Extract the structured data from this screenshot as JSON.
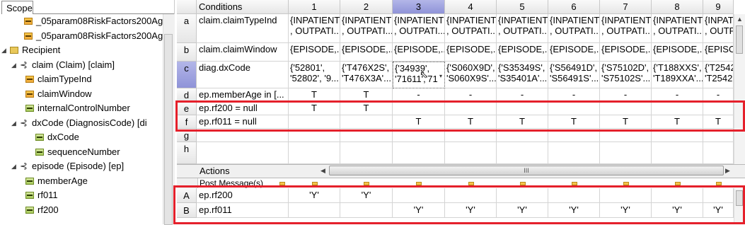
{
  "scope": {
    "tab_label": "Scope",
    "tree": [
      {
        "label": "_05param08RiskFactors200Ag",
        "icon": "field-icon"
      },
      {
        "label": "_05param08RiskFactors200Ag",
        "icon": "field-icon"
      },
      {
        "label": "Recipient",
        "icon": "object-icon",
        "toggle": "◢"
      },
      {
        "label": "claim (Claim) [claim]",
        "icon": "relation-icon",
        "toggle": "◢"
      },
      {
        "label": "claimTypeInd",
        "icon": "field-icon"
      },
      {
        "label": "claimWindow",
        "icon": "field-icon"
      },
      {
        "label": "internalControlNumber",
        "icon": "green-field-icon"
      },
      {
        "label": "dxCode (DiagnosisCode) [di",
        "icon": "relation-icon",
        "toggle": "◢"
      },
      {
        "label": "dxCode",
        "icon": "green-field-icon"
      },
      {
        "label": "sequenceNumber",
        "icon": "green-field-icon"
      },
      {
        "label": "episode (Episode) [ep]",
        "icon": "relation-icon",
        "toggle": "◢"
      },
      {
        "label": "memberAge",
        "icon": "green-field-icon"
      },
      {
        "label": "rf011",
        "icon": "green-field-icon"
      },
      {
        "label": "rf200",
        "icon": "green-field-icon"
      }
    ]
  },
  "grid": {
    "conditions_header": "Conditions",
    "columns": [
      "1",
      "2",
      "3",
      "4",
      "5",
      "6",
      "7",
      "8",
      "9"
    ],
    "selected_column": "3",
    "conditions": [
      {
        "letter": "a",
        "label": "claim.claimTypeInd",
        "cells": [
          [
            "{INPATIENT",
            ", OUTPATI..."
          ],
          [
            "{INPATIENT",
            ", OUTPATI..."
          ],
          [
            "{INPATIENT",
            ", OUTPATI..."
          ],
          [
            "{INPATIENT",
            ", OUTPATI..."
          ],
          [
            "{INPATIENT",
            ", OUTPATI..."
          ],
          [
            "{INPATIENT",
            ", OUTPATI..."
          ],
          [
            "{INPATIENT",
            ", OUTPATI..."
          ],
          [
            "{INPATIENT",
            ", OUTPATI..."
          ],
          [
            "{INPATIEN",
            ", OUTPAT"
          ]
        ]
      },
      {
        "letter": "b",
        "label": "claim.claimWindow",
        "cells": [
          [
            "{EPISODE,..."
          ],
          [
            "{EPISODE,..."
          ],
          [
            "{EPISODE,..."
          ],
          [
            "{EPISODE,..."
          ],
          [
            "{EPISODE,..."
          ],
          [
            "{EPISODE,..."
          ],
          [
            "{EPISODE,..."
          ],
          [
            "{EPISODE,..."
          ],
          [
            "{EPISO"
          ]
        ]
      },
      {
        "letter": "c",
        "label": "diag.dxCode",
        "cells": [
          [
            "{'52801',",
            "'52802', '9..."
          ],
          [
            "{'T476X2S',",
            "'T476X3A'..."
          ],
          [
            "{'34939',",
            "'71611','71"
          ],
          [
            "{'S060X9D',",
            "'S060X9S'..."
          ],
          [
            "{'S35349S',",
            "'S35401A'..."
          ],
          [
            "{'S56491D',",
            "'S56491S'..."
          ],
          [
            "{'S75102D',",
            "'S75102S'..."
          ],
          [
            "{'T188XXS',",
            "'T189XXA'..."
          ],
          [
            "{'T2542",
            "'T2542"
          ]
        ]
      },
      {
        "letter": "d",
        "label": "ep.memberAge in [...",
        "cells": [
          [
            "T"
          ],
          [
            "T"
          ],
          [
            "-"
          ],
          [
            "-"
          ],
          [
            "-"
          ],
          [
            "-"
          ],
          [
            "-"
          ],
          [
            "-"
          ],
          [
            "-"
          ]
        ]
      },
      {
        "letter": "e",
        "label": "ep.rf200 = null",
        "cells": [
          [
            "T"
          ],
          [
            "T"
          ],
          [
            ""
          ],
          [
            ""
          ],
          [
            ""
          ],
          [
            ""
          ],
          [
            ""
          ],
          [
            ""
          ],
          [
            ""
          ]
        ]
      },
      {
        "letter": "f",
        "label": "ep.rf011 = null",
        "cells": [
          [
            ""
          ],
          [
            ""
          ],
          [
            "T"
          ],
          [
            "T"
          ],
          [
            "T"
          ],
          [
            "T"
          ],
          [
            "T"
          ],
          [
            "T"
          ],
          [
            "T"
          ]
        ]
      },
      {
        "letter": "g",
        "label": "",
        "cells": [
          [
            ""
          ],
          [
            ""
          ],
          [
            ""
          ],
          [
            ""
          ],
          [
            ""
          ],
          [
            ""
          ],
          [
            ""
          ],
          [
            ""
          ],
          [
            ""
          ]
        ]
      },
      {
        "letter": "h",
        "label": "",
        "cells": [
          [
            ""
          ],
          [
            ""
          ],
          [
            ""
          ],
          [
            ""
          ],
          [
            ""
          ],
          [
            ""
          ],
          [
            ""
          ],
          [
            ""
          ],
          [
            ""
          ]
        ]
      }
    ],
    "actions_header": "Actions",
    "hscroll_grip": "III",
    "post_message_label": "Post Message(s)",
    "actions": [
      {
        "letter": "A",
        "label": "ep.rf200",
        "cells": [
          "'Y'",
          "'Y'",
          "",
          "",
          "",
          "",
          "",
          "",
          ""
        ]
      },
      {
        "letter": "B",
        "label": "ep.rf011",
        "cells": [
          "",
          "",
          "'Y'",
          "'Y'",
          "'Y'",
          "'Y'",
          "'Y'",
          "'Y'",
          "'Y'"
        ]
      }
    ],
    "highlight_color": "#e5202b",
    "selected_header_color": "#9397dc"
  }
}
